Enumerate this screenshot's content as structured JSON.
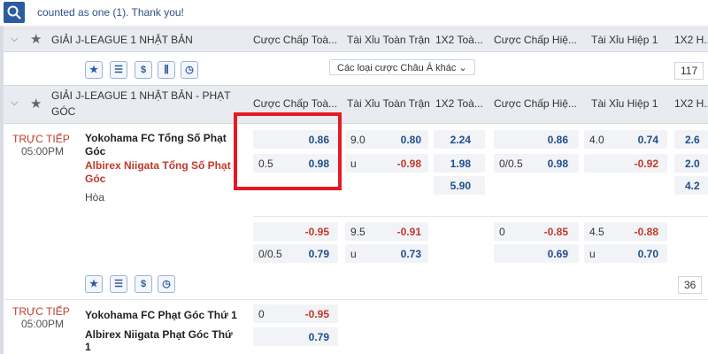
{
  "top": {
    "message": "counted as one (1). Thank you!",
    "search_icon": "search-icon"
  },
  "league1": {
    "name": "GIẢI J-LEAGUE 1 NHẬT BẢN",
    "columns": [
      "Cược Chấp Toà...",
      "Tài Xỉu Toàn Trận",
      "1X2 Toà...",
      "Cược Chấp Hiệ...",
      "Tài Xỉu Hiệp 1",
      "1X2 H..."
    ],
    "other_bets": "Các loại cược Châu Á khác ⌄",
    "count": "117"
  },
  "league2": {
    "name_line1": "GIẢI J-LEAGUE 1 NHẬT BẢN - PHẠT",
    "name_line2": "GÓC",
    "columns": [
      "Cược Chấp Toà...",
      "Tài Xỉu Toàn Trận",
      "1X2 Toà...",
      "Cược Chấp Hiệ...",
      "Tài Xỉu Hiệp 1",
      "1X2 H..."
    ],
    "count": "36"
  },
  "match1": {
    "status": "TRỰC TIẾP",
    "time": "05:00PM",
    "home_l1": "Yokohama FC Tổng Số Phạt",
    "home_l2": "Góc",
    "away_l1": "Albirex Niigata Tổng Số Phạt",
    "away_l2": "Góc",
    "draw": "Hòa",
    "a": {
      "ft_hcap_home": "0.86",
      "ft_hcap_line": "0.5",
      "ft_hcap_away": "0.98",
      "ft_ou_line": "9.0",
      "ft_ou_over": "0.80",
      "ft_ou_u": "u",
      "ft_ou_under": "-0.98",
      "x12_1": "2.24",
      "x12_2": "1.98",
      "x12_x": "5.90",
      "h1_hcap_home": "0.86",
      "h1_hcap_line": "0/0.5",
      "h1_hcap_away": "0.98",
      "h1_ou_line": "4.0",
      "h1_ou_over": "0.74",
      "h1_ou_under": "-0.92",
      "h1x2_1": "2.6",
      "h1x2_2": "2.0",
      "h1x2_x": "4.2"
    },
    "b": {
      "ft_hcap_home": "-0.95",
      "ft_hcap_line": "0/0.5",
      "ft_hcap_away": "0.79",
      "ft_ou_line": "9.5",
      "ft_ou_over": "-0.91",
      "ft_ou_u": "u",
      "ft_ou_under": "0.73",
      "h1_hcap_line": "0",
      "h1_hcap_home": "-0.85",
      "h1_hcap_away": "0.69",
      "h1_ou_line": "4.5",
      "h1_ou_over": "-0.88",
      "h1_ou_u": "u",
      "h1_ou_under": "0.70"
    }
  },
  "match2": {
    "status": "TRỰC TIẾP",
    "time": "05:00PM",
    "home": "Yokohama FC Phạt Góc Thứ 1",
    "away_l1": "Albirex Niigata Phạt Góc Thứ",
    "away_l2": "1",
    "hcap_line": "0",
    "hcap_home": "-0.95",
    "hcap_away": "0.79"
  },
  "colors": {
    "accent": "#2d5c9e",
    "highlight": "#e31b23",
    "negative": "#c0392b",
    "positive": "#1f4e8c"
  }
}
